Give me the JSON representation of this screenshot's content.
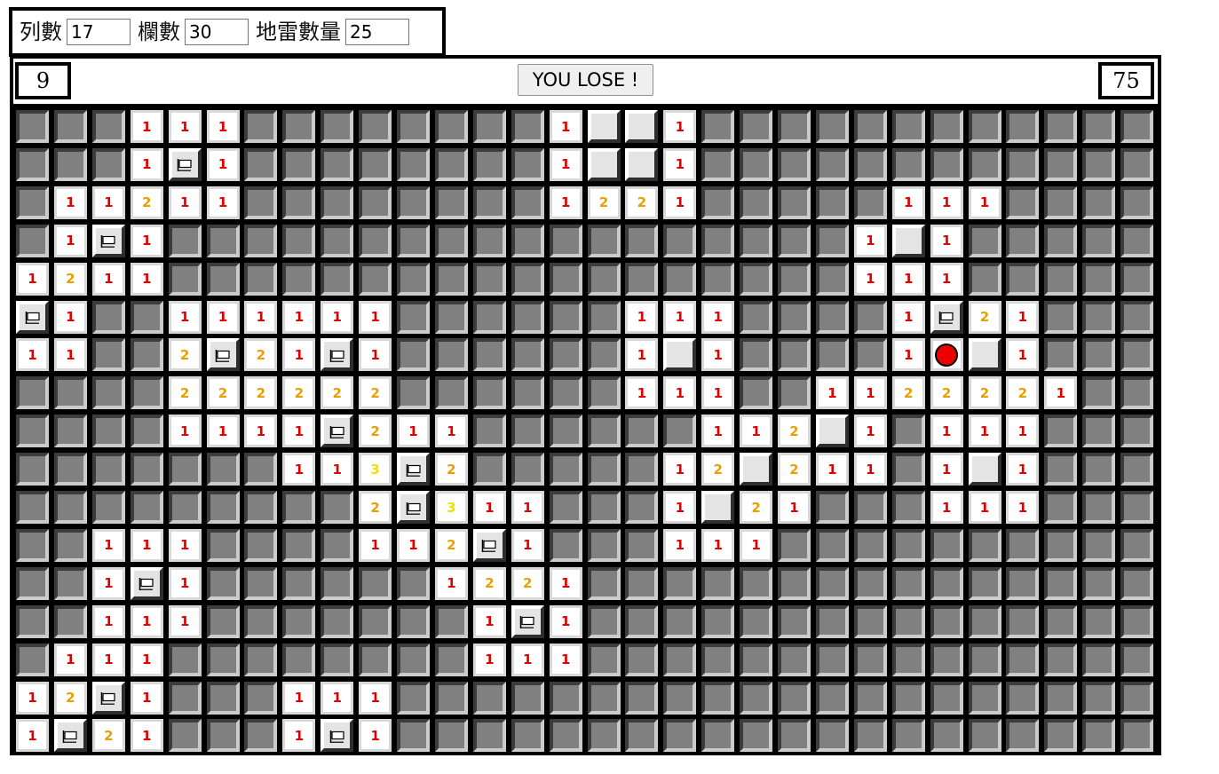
{
  "settings": {
    "rows_label": "列數",
    "rows_value": "17",
    "cols_label": "欄數",
    "cols_value": "30",
    "mines_label": "地雷數量",
    "mines_value": "25"
  },
  "status": {
    "mine_counter": "9",
    "face_button": "YOU LOSE !",
    "timer": "75"
  },
  "legend": {
    "H": "hidden cell",
    "E": "revealed empty cell",
    "F": "flag-icon",
    "M": "mine-icon (exploded)",
    "digits": "revealed number cell"
  },
  "colors": {
    "one": "#e00000",
    "two": "#e8a000",
    "three": "#f0e000",
    "hidden": "#808080",
    "mine": "#ee0000"
  },
  "board": [
    "HHH111HHHHHHHH1EE1HHHHHHHHHHHH",
    "HHH1F1HHHHHHHH1EE1HHHHHHHHHHHH",
    "H11211HHHHHHHH1221HHHHH111HHHH",
    "H1F1HHHHHHHHHHHHHHHHHH1E1HHHHH",
    "1211HHHHHHHHHHHHHHHHHH111HHHHH",
    "F1HH111111HHHHHH111HHHH1F21HHHH",
    "11HH2F21F1HHHHHH1E1HHHH1ME1HHHH",
    "HHHH222222HHHHHH111HH1122221HHHH",
    "HHHH1111F211HHHHHH112E1H111HHH",
    "HHHHHHH113F2HHHHH12E211H1E1HHH",
    "HHHHHHHHH2F311HHH1E21HHH111HHH",
    "HH111HHHH112F1HHH111HHHHHHHHHH",
    "HH1F1HHHHHH1221HHHHHHHHHHHHHHH",
    "HH111HHHHHHH1F1HHHHHHHHHHHHHHH",
    "H111HHHHHHHH111HHHHHHHHHHHHHHH",
    "12F1HHH111HHHHHHHHHHHHHHHHHHHH",
    "1F21HHH1F1HHHHHHHHHHHHHHHHHHHH"
  ]
}
